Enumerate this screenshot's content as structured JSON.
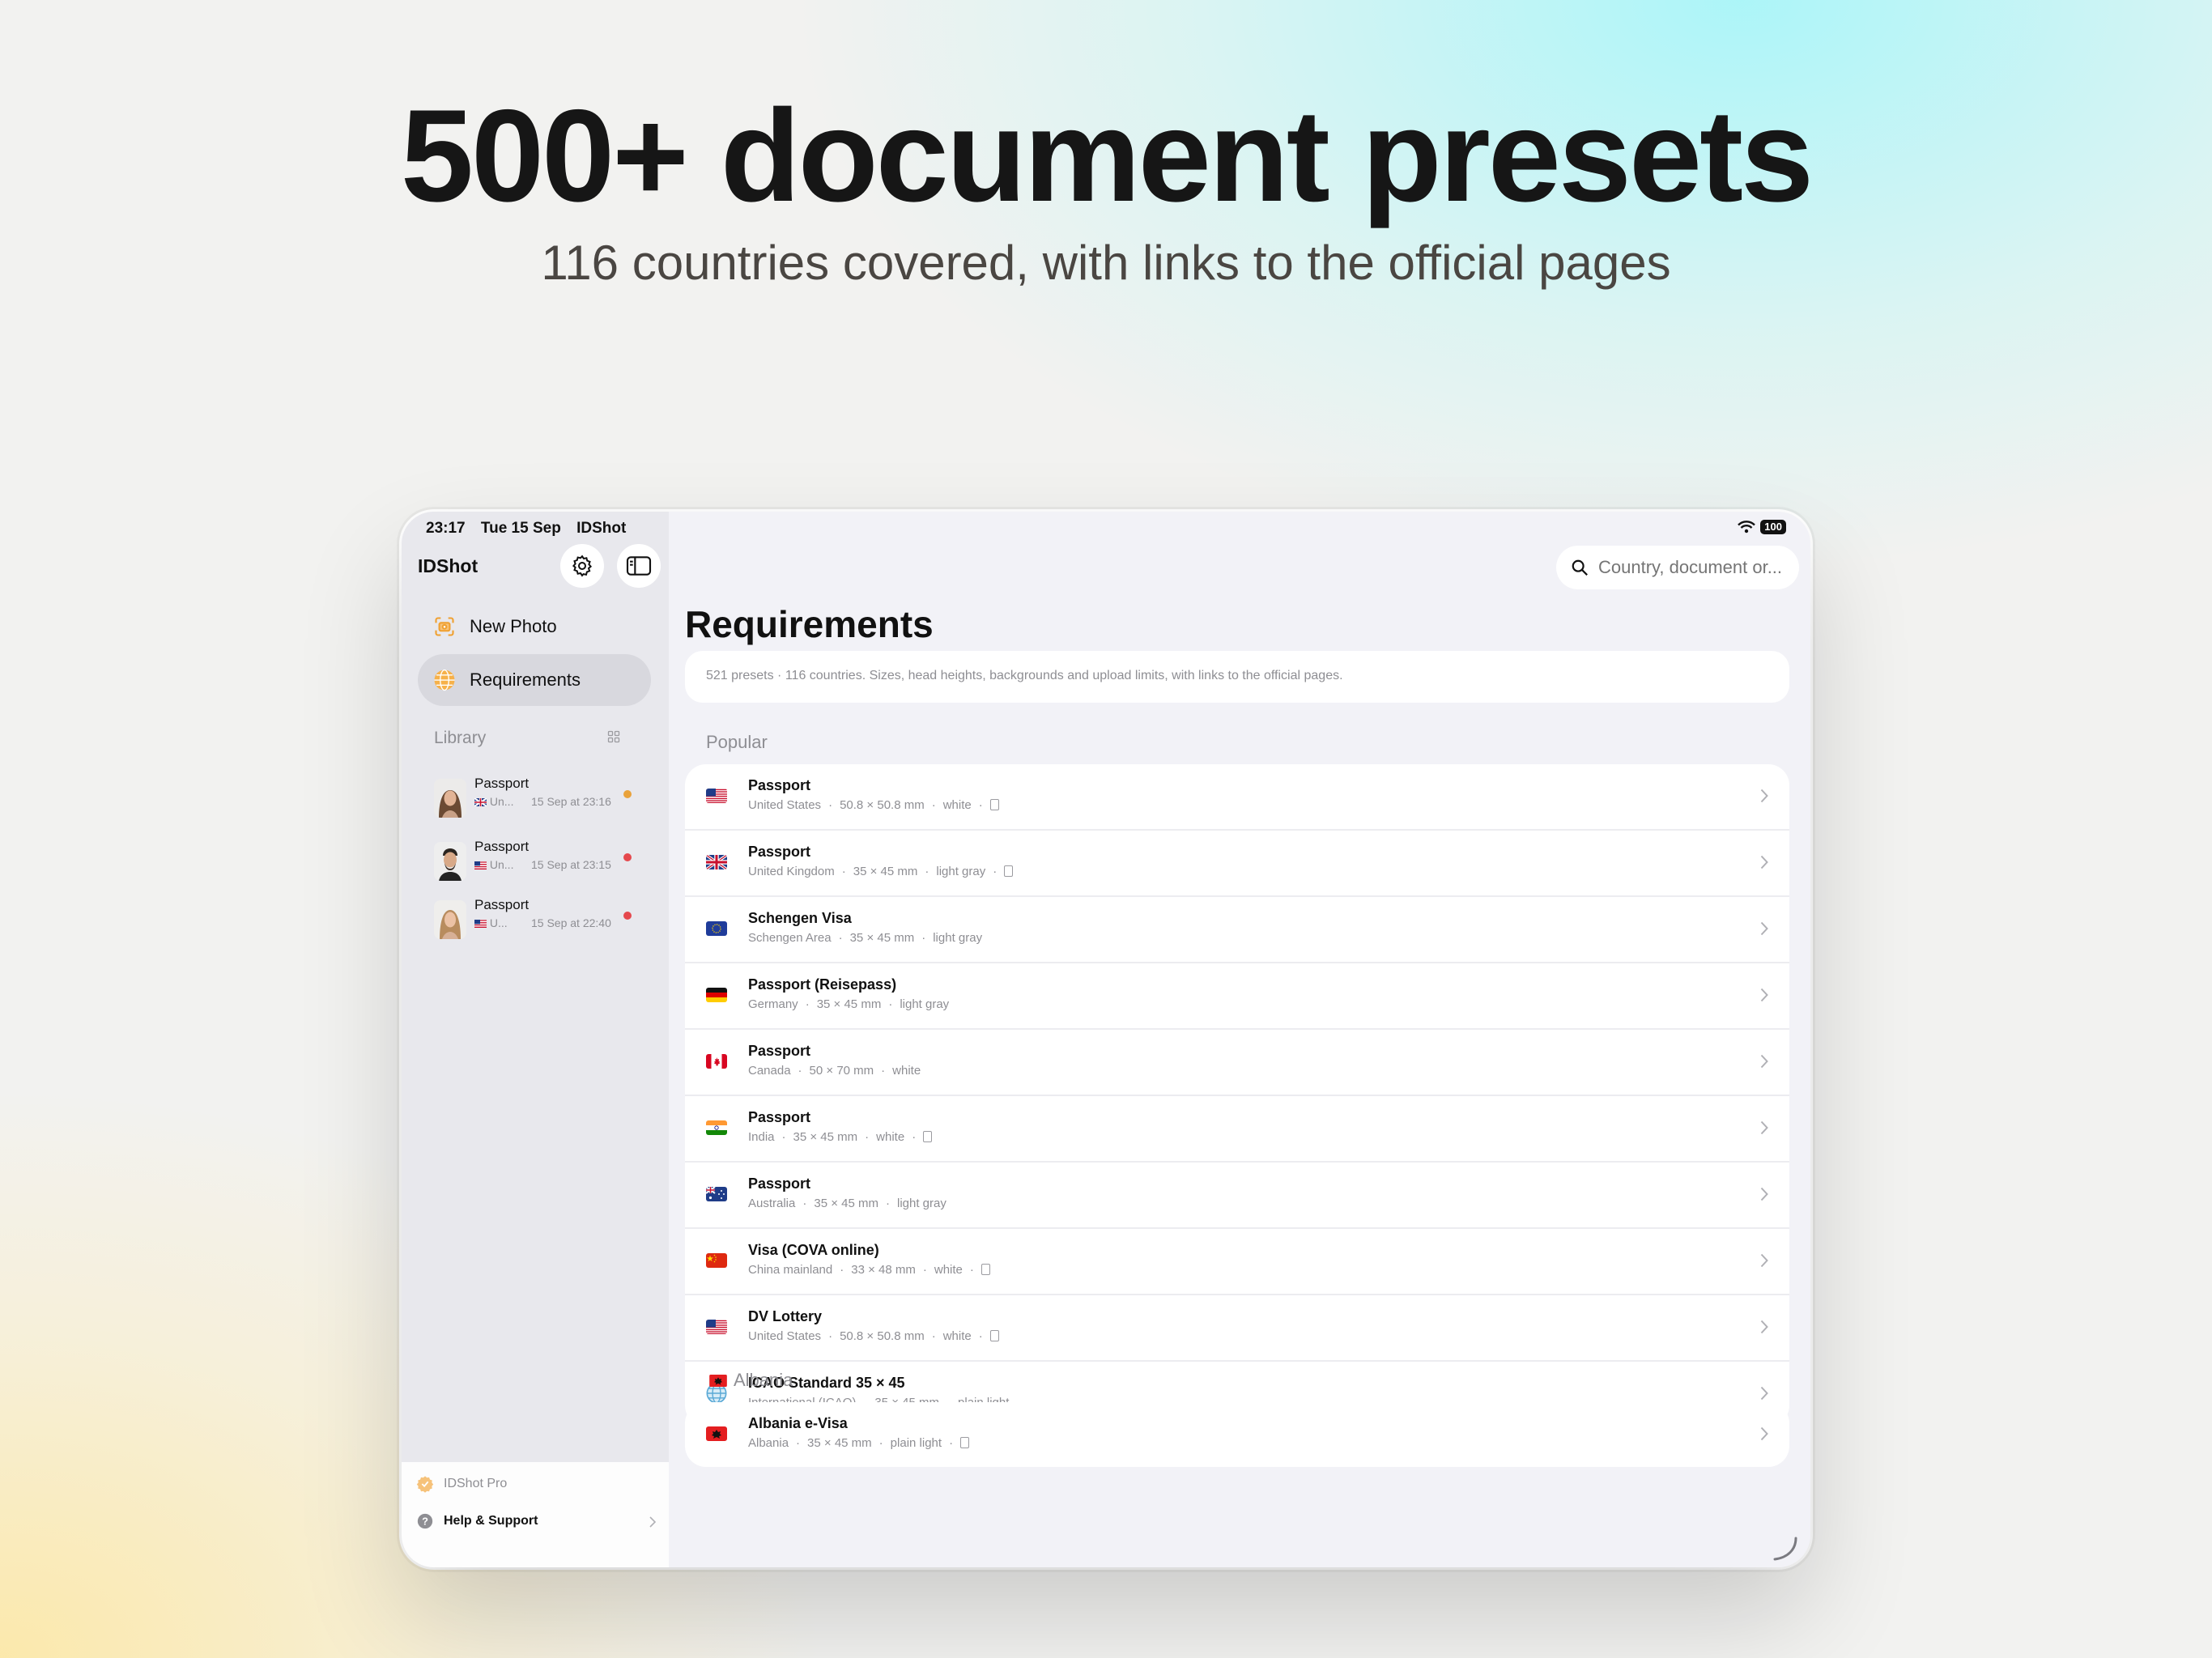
{
  "hero": {
    "title": "500+ document presets",
    "subtitle": "116 countries covered, with links to the official pages"
  },
  "status_bar": {
    "time": "23:17",
    "date": "Tue 15 Sep",
    "app": "IDShot",
    "battery": "100"
  },
  "sidebar": {
    "app_title": "IDShot",
    "nav": [
      {
        "label": "New Photo",
        "icon": "camera-icon"
      },
      {
        "label": "Requirements",
        "icon": "globe-icon",
        "active": true
      }
    ],
    "library_label": "Library",
    "library": [
      {
        "title": "Passport",
        "country": "Un...",
        "date": "15 Sep at 23:16",
        "status_color": "#e9a23b"
      },
      {
        "title": "Passport",
        "country": "Un...",
        "date": "15 Sep at 23:15",
        "status_color": "#e5484d"
      },
      {
        "title": "Passport",
        "country": "U...",
        "date": "15 Sep at 22:40",
        "status_color": "#e5484d"
      }
    ],
    "footer": {
      "pro_label": "IDShot Pro",
      "help_label": "Help & Support"
    }
  },
  "main": {
    "search_placeholder": "Country, document or...",
    "title": "Requirements",
    "summary": "521 presets · 116 countries. Sizes, head heights, backgrounds and upload limits, with links to the official pages.",
    "sections": [
      {
        "header": "Popular",
        "items": [
          {
            "title": "Passport",
            "country": "United States",
            "size": "50.8 × 50.8 mm",
            "background": "white",
            "flag": "us",
            "upload_limit": true
          },
          {
            "title": "Passport",
            "country": "United Kingdom",
            "size": "35 × 45 mm",
            "background": "light gray",
            "flag": "gb",
            "upload_limit": true
          },
          {
            "title": "Schengen Visa",
            "country": "Schengen Area",
            "size": "35 × 45 mm",
            "background": "light gray",
            "flag": "eu",
            "upload_limit": false
          },
          {
            "title": "Passport (Reisepass)",
            "country": "Germany",
            "size": "35 × 45 mm",
            "background": "light gray",
            "flag": "de",
            "upload_limit": false
          },
          {
            "title": "Passport",
            "country": "Canada",
            "size": "50 × 70 mm",
            "background": "white",
            "flag": "ca",
            "upload_limit": false
          },
          {
            "title": "Passport",
            "country": "India",
            "size": "35 × 45 mm",
            "background": "white",
            "flag": "in",
            "upload_limit": true
          },
          {
            "title": "Passport",
            "country": "Australia",
            "size": "35 × 45 mm",
            "background": "light gray",
            "flag": "au",
            "upload_limit": false
          },
          {
            "title": "Visa (COVA online)",
            "country": "China mainland",
            "size": "33 × 48 mm",
            "background": "white",
            "flag": "cn",
            "upload_limit": true
          },
          {
            "title": "DV Lottery",
            "country": "United States",
            "size": "50.8 × 50.8 mm",
            "background": "white",
            "flag": "us",
            "upload_limit": true
          },
          {
            "title": "ICAO Standard 35 × 45",
            "country": "International (ICAO)",
            "size": "35 × 45 mm",
            "background": "plain light",
            "flag": "globe",
            "upload_limit": false
          }
        ]
      },
      {
        "header": "Albania",
        "header_flag": "al",
        "items": [
          {
            "title": "Albania e-Visa",
            "country": "Albania",
            "size": "35 × 45 mm",
            "background": "plain light",
            "flag": "al",
            "upload_limit": true
          }
        ]
      }
    ]
  },
  "colors": {
    "accent": "#f0a030",
    "sidebar_bg": "#e8e8ed",
    "main_bg": "#f2f2f7",
    "text_secondary": "#8e8e93"
  }
}
